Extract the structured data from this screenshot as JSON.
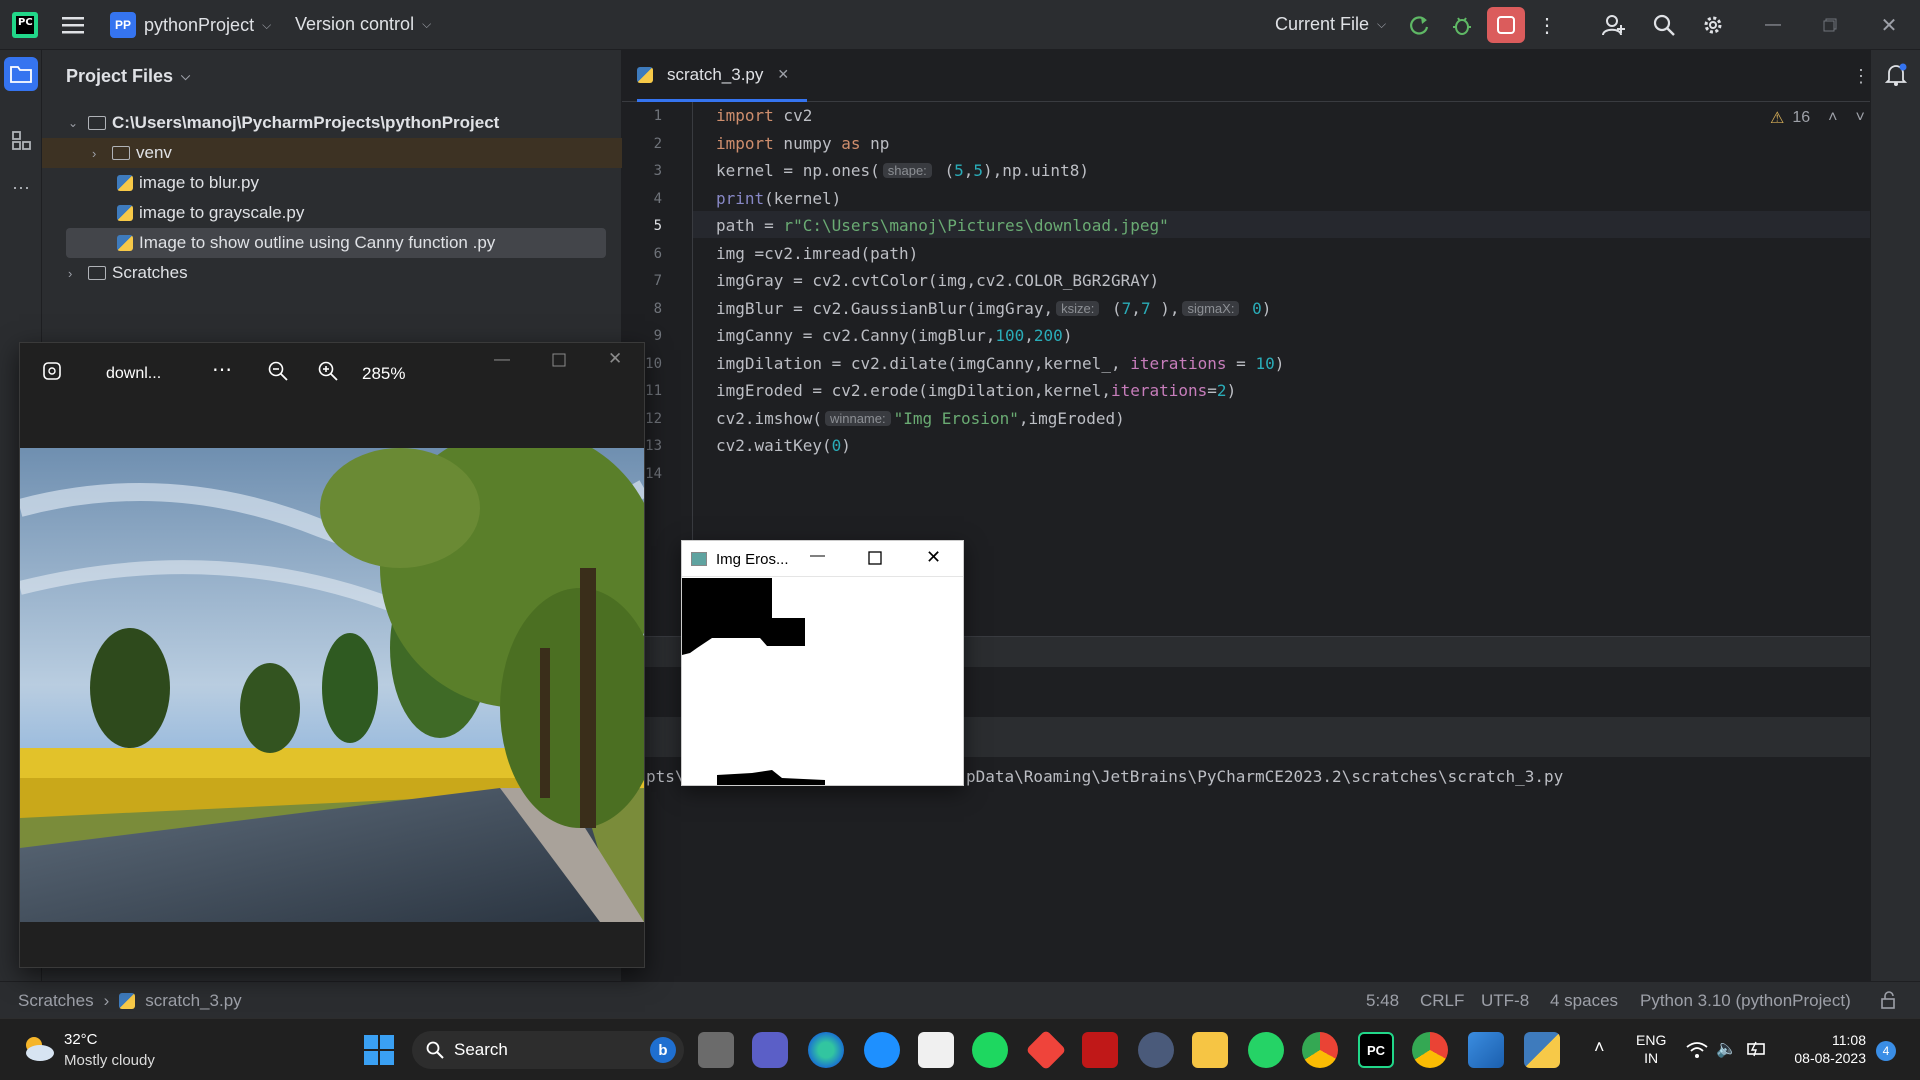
{
  "titlebar": {
    "app_logo": "PC",
    "project_badge": "PP",
    "project_name": "pythonProject",
    "vcs": "Version control",
    "run_config": "Current File"
  },
  "project_panel": {
    "title": "Project Files",
    "tree": [
      {
        "label": "C:\\Users\\manoj\\PycharmProjects\\pythonProject",
        "type": "folder",
        "expanded": true
      },
      {
        "label": "venv",
        "type": "folder",
        "expanded": false
      },
      {
        "label": "image to blur.py",
        "type": "py"
      },
      {
        "label": "image to grayscale.py",
        "type": "py"
      },
      {
        "label": "Image to show outline using Canny function .py",
        "type": "py",
        "selected": true
      },
      {
        "label": "Scratches",
        "type": "folder",
        "expanded": false
      }
    ]
  },
  "editor": {
    "tab": "scratch_3.py",
    "warnings": "16",
    "line_numbers": [
      "1",
      "2",
      "3",
      "4",
      "5",
      "6",
      "7",
      "8",
      "9",
      "10",
      "11",
      "12",
      "13",
      "14"
    ],
    "lines": [
      [
        [
          "kw",
          "import"
        ],
        [
          "fn",
          " cv2"
        ]
      ],
      [
        [
          "kw",
          "import"
        ],
        [
          "fn",
          " numpy "
        ],
        [
          "kw",
          "as"
        ],
        [
          "fn",
          " np"
        ]
      ],
      [
        [
          "fn",
          "kernel = np.ones("
        ],
        [
          "hint",
          "shape:"
        ],
        [
          "fn",
          " ("
        ],
        [
          "num",
          "5"
        ],
        [
          "fn",
          ","
        ],
        [
          "num",
          "5"
        ],
        [
          "fn",
          "),np.uint8)"
        ]
      ],
      [
        [
          "bi",
          "print"
        ],
        [
          "fn",
          "(kernel)"
        ]
      ],
      [
        [
          "fn",
          "path = "
        ],
        [
          "str",
          "r\"C:\\Users\\manoj\\Pictures\\download.jpeg\""
        ]
      ],
      [
        [
          "fn",
          "img =cv2.imread(path)"
        ]
      ],
      [
        [
          "fn",
          "imgGray = cv2.cvtColor(img,cv2.COLOR_BGR2GRAY)"
        ]
      ],
      [
        [
          "fn",
          "imgBlur = cv2.GaussianBlur(imgGray,"
        ],
        [
          "hint",
          "ksize:"
        ],
        [
          "fn",
          " ("
        ],
        [
          "num",
          "7"
        ],
        [
          "fn",
          ","
        ],
        [
          "num",
          "7"
        ],
        [
          "fn",
          " ),"
        ],
        [
          "hint",
          "sigmaX:"
        ],
        [
          "fn",
          " "
        ],
        [
          "num",
          "0"
        ],
        [
          "fn",
          ")"
        ]
      ],
      [
        [
          "fn",
          "imgCanny = cv2.Canny(imgBlur,"
        ],
        [
          "num",
          "100"
        ],
        [
          "fn",
          ","
        ],
        [
          "num",
          "200"
        ],
        [
          "fn",
          ")"
        ]
      ],
      [
        [
          "fn",
          "imgDilation = cv2.dilate(imgCanny,kernel_, "
        ],
        [
          "prm",
          "iterations"
        ],
        [
          "fn",
          " = "
        ],
        [
          "num",
          "10"
        ],
        [
          "fn",
          ")"
        ]
      ],
      [
        [
          "fn",
          "imgEroded = cv2.erode(imgDilation,kernel,"
        ],
        [
          "prm",
          "iterations"
        ],
        [
          "fn",
          "="
        ],
        [
          "num",
          "2"
        ],
        [
          "fn",
          ")"
        ]
      ],
      [
        [
          "fn",
          "cv2.imshow("
        ],
        [
          "hint",
          "winname:"
        ],
        [
          "str",
          "\"Img Erosion\""
        ],
        [
          "fn",
          ",imgEroded)"
        ]
      ],
      [
        [
          "fn",
          "cv2.waitKey("
        ],
        [
          "num",
          "0"
        ],
        [
          "fn",
          ")"
        ]
      ],
      []
    ],
    "run_output_left": "pts\\",
    "run_output_right": "pData\\Roaming\\JetBrains\\PyCharmCE2023.2\\scratches\\scratch_3.py"
  },
  "photo_viewer": {
    "filename": "downl...",
    "zoom": "285%"
  },
  "erosion_window": {
    "title": "Img Eros..."
  },
  "statusbar": {
    "crumb_root": "Scratches",
    "crumb_file": "scratch_3.py",
    "position": "5:48",
    "line_sep": "CRLF",
    "encoding": "UTF-8",
    "indent": "4 spaces",
    "interpreter": "Python 3.10 (pythonProject)"
  },
  "taskbar": {
    "temp": "32°C",
    "weather": "Mostly cloudy",
    "search": "Search",
    "lang_1": "ENG",
    "lang_2": "IN",
    "time": "11:08",
    "date": "08-08-2023",
    "notif_count": "4",
    "app_icons": [
      "task-view-icon",
      "teams-icon",
      "edge-icon",
      "safari-icon",
      "store-icon",
      "spotify-icon",
      "anydesk-icon",
      "mcafee-icon",
      "settings-icon",
      "file-explorer-icon",
      "whatsapp-icon",
      "chrome-icon",
      "pycharm-icon",
      "chrome-profile-icon",
      "photos-icon",
      "python-icon"
    ]
  },
  "colors": {
    "accent": "#3574f0",
    "stop_button": "#db5c5c",
    "run_green": "#5fb865"
  }
}
